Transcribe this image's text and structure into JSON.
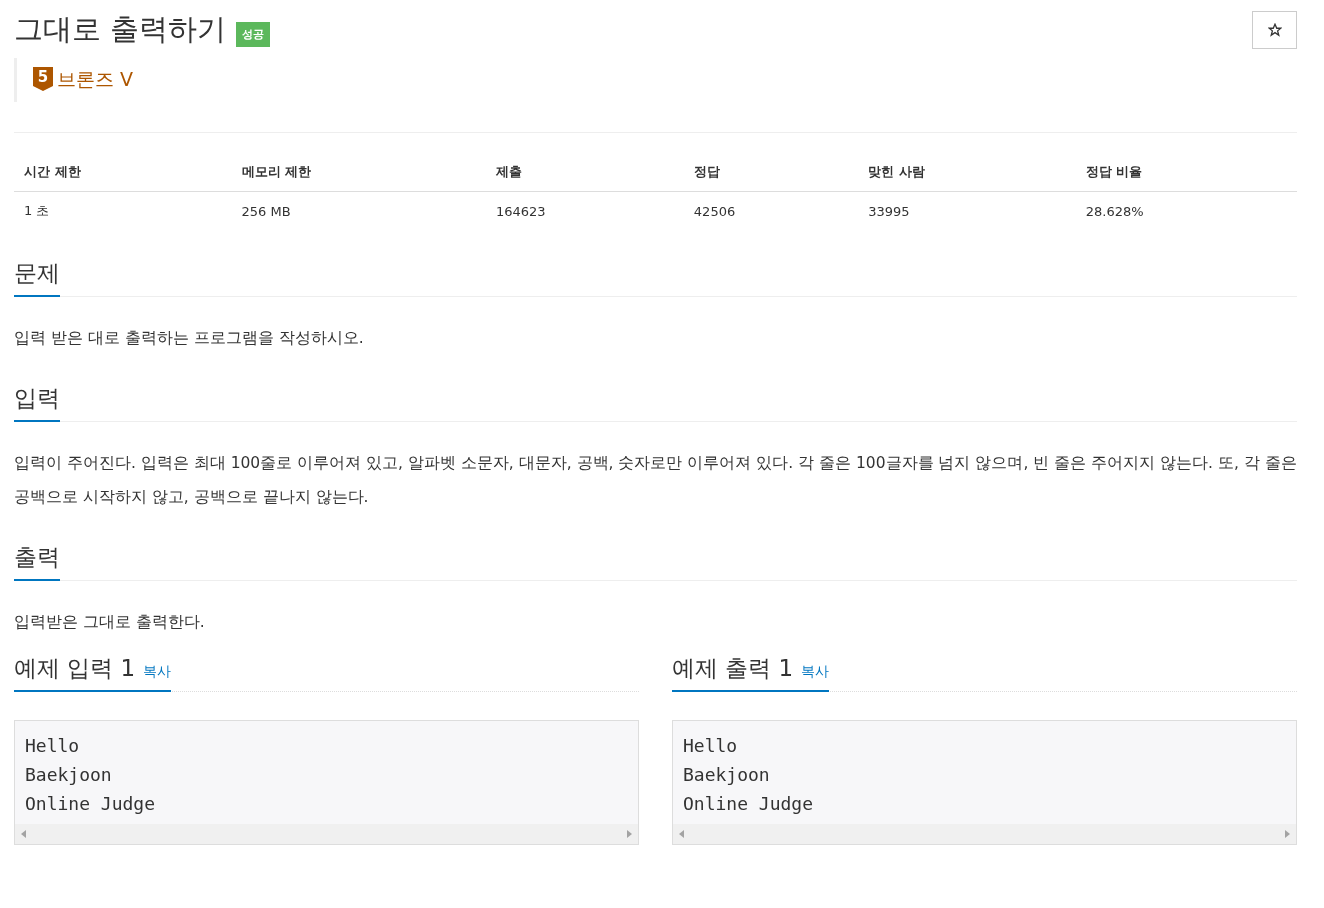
{
  "title": "그대로 출력하기",
  "result_badge": "성공",
  "tier": {
    "number": "5",
    "name": "브론즈 V"
  },
  "stats": {
    "columns": [
      "시간 제한",
      "메모리 제한",
      "제출",
      "정답",
      "맞힌 사람",
      "정답 비율"
    ],
    "row": [
      "1 초",
      "256 MB",
      "164623",
      "42506",
      "33995",
      "28.628%"
    ]
  },
  "sections": [
    {
      "heading": "문제",
      "body": "입력 받은 대로 출력하는 프로그램을 작성하시오."
    },
    {
      "heading": "입력",
      "body": "입력이 주어진다. 입력은 최대 100줄로 이루어져 있고, 알파벳 소문자, 대문자, 공백, 숫자로만 이루어져 있다. 각 줄은 100글자를 넘지 않으며, 빈 줄은 주어지지 않는다. 또, 각 줄은 공백으로 시작하지 않고, 공백으로 끝나지 않는다."
    },
    {
      "heading": "출력",
      "body": "입력받은 그대로 출력한다."
    }
  ],
  "samples": [
    {
      "heading": "예제 입력 1",
      "copy": "복사",
      "lines": [
        "Hello",
        "Baekjoon",
        "Online Judge"
      ]
    },
    {
      "heading": "예제 출력 1",
      "copy": "복사",
      "lines": [
        "Hello",
        "Baekjoon",
        "Online Judge"
      ]
    }
  ]
}
